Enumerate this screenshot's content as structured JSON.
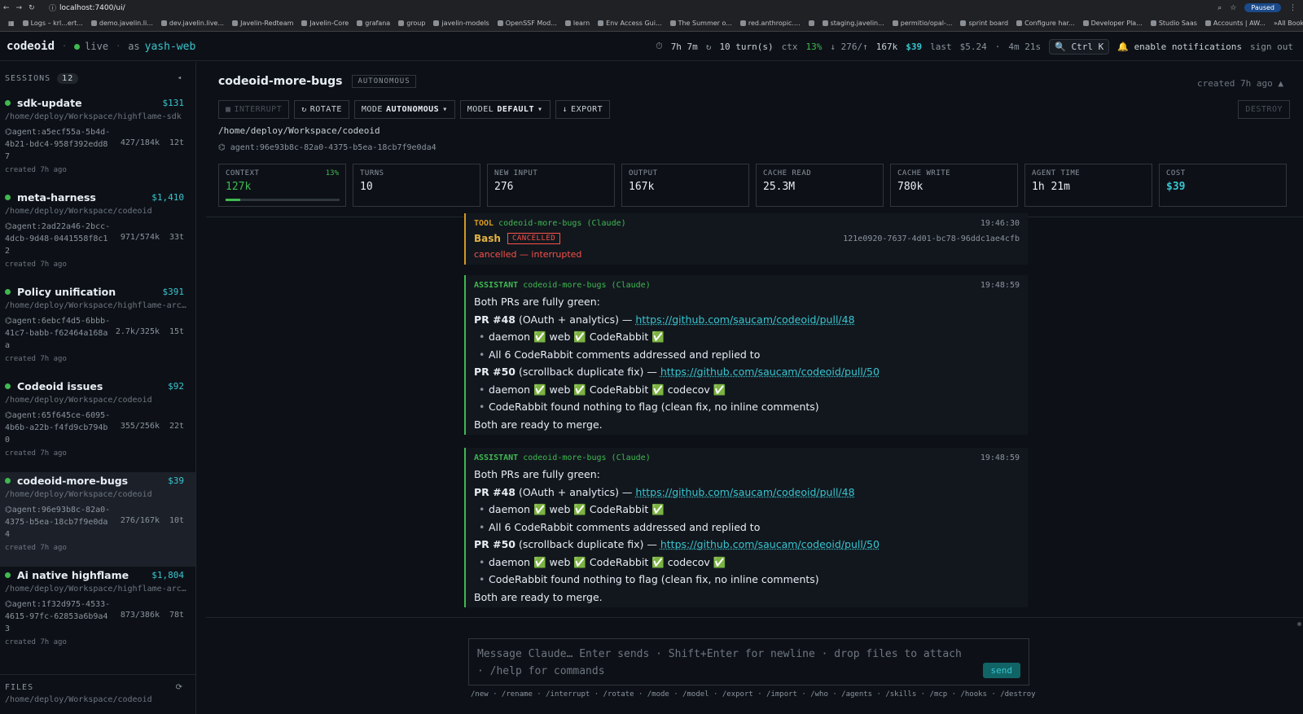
{
  "browser": {
    "url": "localhost:7400/ui/",
    "paused": "Paused",
    "bookmarks": [
      "Logs – krl...ert...",
      "demo.javelin.li...",
      "dev.javelin.live...",
      "Javelin-Redteam",
      "Javelin-Core",
      "grafana",
      "group",
      "javelin-models",
      "OpenSSF Mod...",
      "learn",
      "Env Access Gui...",
      "The Summer o...",
      "red.anthropic....",
      "",
      "staging.javelin...",
      "permitio/opal-...",
      "sprint board",
      "Configure har...",
      "Developer Pla...",
      "Studio Saas",
      "Accounts | AW...",
      "»"
    ],
    "all_bookmarks": "All Bookmarks"
  },
  "header": {
    "brand": "codeoid",
    "status": "live",
    "as_label": "as",
    "user": "yash-web",
    "uptime": "7h 7m",
    "turns": "10 turn(s)",
    "ctx_label": "ctx",
    "ctx_value": "13%",
    "tokens_prefix": "↓ 276/↑",
    "tokens_out": "167k",
    "cost": "$39",
    "last_label": "last",
    "last_cost": "$5.24",
    "last_time": "4m 21s",
    "shortcut": "Ctrl K",
    "notifications": "enable notifications",
    "signout": "sign out"
  },
  "sidebar": {
    "title": "SESSIONS",
    "count": "12",
    "collapse": "◂",
    "sessions": [
      {
        "name": "sdk-update",
        "cost": "$131",
        "path": "/home/deploy/Workspace/highflame-sdk",
        "agent": "agent:a5ecf55a-5b4d-4b21-bdc4-958f392edd87",
        "tokens": "427/184k",
        "turns": "12t",
        "created": "created 7h ago"
      },
      {
        "name": "meta-harness",
        "cost": "$1,410",
        "path": "/home/deploy/Workspace/codeoid",
        "agent": "agent:2ad22a46-2bcc-4dcb-9d48-0441558f8c12",
        "tokens": "971/574k",
        "turns": "33t",
        "created": "created 7h ago"
      },
      {
        "name": "Policy unification",
        "cost": "$391",
        "path": "/home/deploy/Workspace/highflame-architect...",
        "agent": "agent:6ebcf4d5-6bbb-41c7-babb-f62464a168aa",
        "tokens": "2.7k/325k",
        "turns": "15t",
        "created": "created 7h ago"
      },
      {
        "name": "Codeoid issues",
        "cost": "$92",
        "path": "/home/deploy/Workspace/codeoid",
        "agent": "agent:65f645ce-6095-4b6b-a22b-f4fd9cb794b0",
        "tokens": "355/256k",
        "turns": "22t",
        "created": "created 7h ago"
      },
      {
        "name": "codeoid-more-bugs",
        "cost": "$39",
        "path": "/home/deploy/Workspace/codeoid",
        "agent": "agent:96e93b8c-82a0-4375-b5ea-18cb7f9e0da4",
        "tokens": "276/167k",
        "turns": "10t",
        "created": "created 7h ago"
      },
      {
        "name": "Ai native highflame",
        "cost": "$1,804",
        "path": "/home/deploy/Workspace/highflame-architect...",
        "agent": "agent:1f32d975-4533-4615-97fc-62853a6b9a43",
        "tokens": "873/386k",
        "turns": "78t",
        "created": "created 7h ago"
      }
    ],
    "files_title": "FILES",
    "files_path": "/home/deploy/Workspace/codeoid"
  },
  "session": {
    "title": "codeoid-more-bugs",
    "badge": "AUTONOMOUS",
    "created": "created 7h ago",
    "toolbar": {
      "interrupt": "INTERRUPT",
      "rotate": "ROTATE",
      "mode_label": "MODE",
      "mode_value": "AUTONOMOUS",
      "model_label": "MODEL",
      "model_value": "DEFAULT",
      "export": "EXPORT",
      "destroy": "DESTROY"
    },
    "cwd": "/home/deploy/Workspace/codeoid",
    "agent": "agent:96e93b8c-82a0-4375-b5ea-18cb7f9e0da4",
    "stats": {
      "context_label": "CONTEXT",
      "context_value": "127k",
      "context_pct": "13%",
      "context_fraction": 0.13,
      "turns_label": "TURNS",
      "turns_value": "10",
      "new_input_label": "NEW INPUT",
      "new_input_value": "276",
      "output_label": "OUTPUT",
      "output_value": "167k",
      "cache_read_label": "CACHE READ",
      "cache_read_value": "25.3M",
      "cache_write_label": "CACHE WRITE",
      "cache_write_value": "780k",
      "agent_time_label": "AGENT TIME",
      "agent_time_value": "1h 21m",
      "cost_label": "COST",
      "cost_value": "$39"
    }
  },
  "transcript": {
    "tool": {
      "role": "TOOL",
      "who": "codeoid-more-bugs (Claude)",
      "time": "19:46:30",
      "name": "Bash",
      "status": "CANCELLED",
      "call_id": "121e0920-7637-4d01-bc78-96ddc1ae4cfb",
      "result": "cancelled — interrupted"
    },
    "assistant": {
      "role": "ASSISTANT",
      "who": "codeoid-more-bugs (Claude)",
      "time": "19:48:59",
      "line1": "Both PRs are fully green:",
      "pr48_label": "PR #48",
      "pr48_desc": "(OAuth + analytics) —",
      "pr48_url": "https://github.com/saucam/codeoid/pull/48",
      "pr48_b1": "daemon ✅ web ✅ CodeRabbit ✅",
      "pr48_b2": "All 6 CodeRabbit comments addressed and replied to",
      "pr50_label": "PR #50",
      "pr50_desc": "(scrollback duplicate fix) —",
      "pr50_url": "https://github.com/saucam/codeoid/pull/50",
      "pr50_b1": "daemon ✅ web ✅ CodeRabbit ✅ codecov ✅",
      "pr50_b2": "CodeRabbit found nothing to flag (clean fix, no inline comments)",
      "closing": "Both are ready to merge."
    }
  },
  "composer": {
    "placeholder": "Message Claude…  Enter sends · Shift+Enter for newline · drop files to attach · /help for commands",
    "send": "send",
    "commands": "/new · /rename · /interrupt · /rotate · /mode · /model · /export · /import · /who · /agents · /skills · /mcp · /hooks · /destroy"
  }
}
